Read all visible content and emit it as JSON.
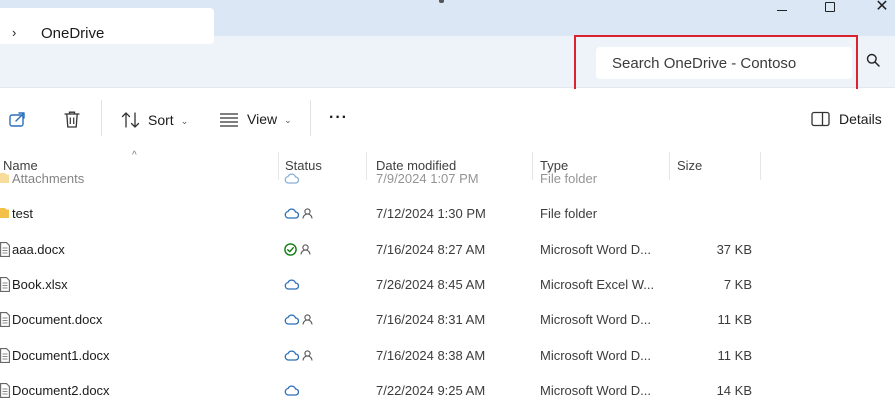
{
  "window": {
    "close_glyph": "✕"
  },
  "address": {
    "chevron": "›",
    "location": "OneDrive"
  },
  "search": {
    "placeholder": "Search OneDrive - Contoso",
    "icon": "search-icon"
  },
  "toolbar": {
    "share_icon": "share-icon",
    "delete_icon": "trash-icon",
    "sort_label": "Sort",
    "view_label": "View",
    "more_label": "···",
    "details_label": "Details"
  },
  "columns": {
    "name": "Name",
    "status": "Status",
    "date": "Date modified",
    "type": "Type",
    "size": "Size",
    "sort_indicator": "^"
  },
  "files": [
    {
      "name": "Attachments",
      "kind": "folder",
      "status": "cloud",
      "shared": false,
      "date": "7/9/2024 1:07 PM",
      "type": "File folder",
      "size": ""
    },
    {
      "name": "test",
      "kind": "folder",
      "status": "cloud",
      "shared": true,
      "date": "7/12/2024 1:30 PM",
      "type": "File folder",
      "size": ""
    },
    {
      "name": "aaa.docx",
      "kind": "doc",
      "status": "synced",
      "shared": true,
      "date": "7/16/2024 8:27 AM",
      "type": "Microsoft Word D...",
      "size": "37 KB"
    },
    {
      "name": "Book.xlsx",
      "kind": "doc",
      "status": "cloud",
      "shared": false,
      "date": "7/26/2024 8:45 AM",
      "type": "Microsoft Excel W...",
      "size": "7 KB"
    },
    {
      "name": "Document.docx",
      "kind": "doc",
      "status": "cloud",
      "shared": true,
      "date": "7/16/2024 8:31 AM",
      "type": "Microsoft Word D...",
      "size": "11 KB"
    },
    {
      "name": "Document1.docx",
      "kind": "doc",
      "status": "cloud",
      "shared": true,
      "date": "7/16/2024 8:38 AM",
      "type": "Microsoft Word D...",
      "size": "11 KB"
    },
    {
      "name": "Document2.docx",
      "kind": "doc",
      "status": "cloud",
      "shared": false,
      "date": "7/22/2024 9:25 AM",
      "type": "Microsoft Word D...",
      "size": "14 KB"
    }
  ],
  "colors": {
    "titlebar": "#dce7f5",
    "addressbar": "#eef3fa",
    "highlight": "#d9242f",
    "cloud": "#2a6fb8",
    "synced": "#107c10",
    "folder": "#f3c14a"
  }
}
